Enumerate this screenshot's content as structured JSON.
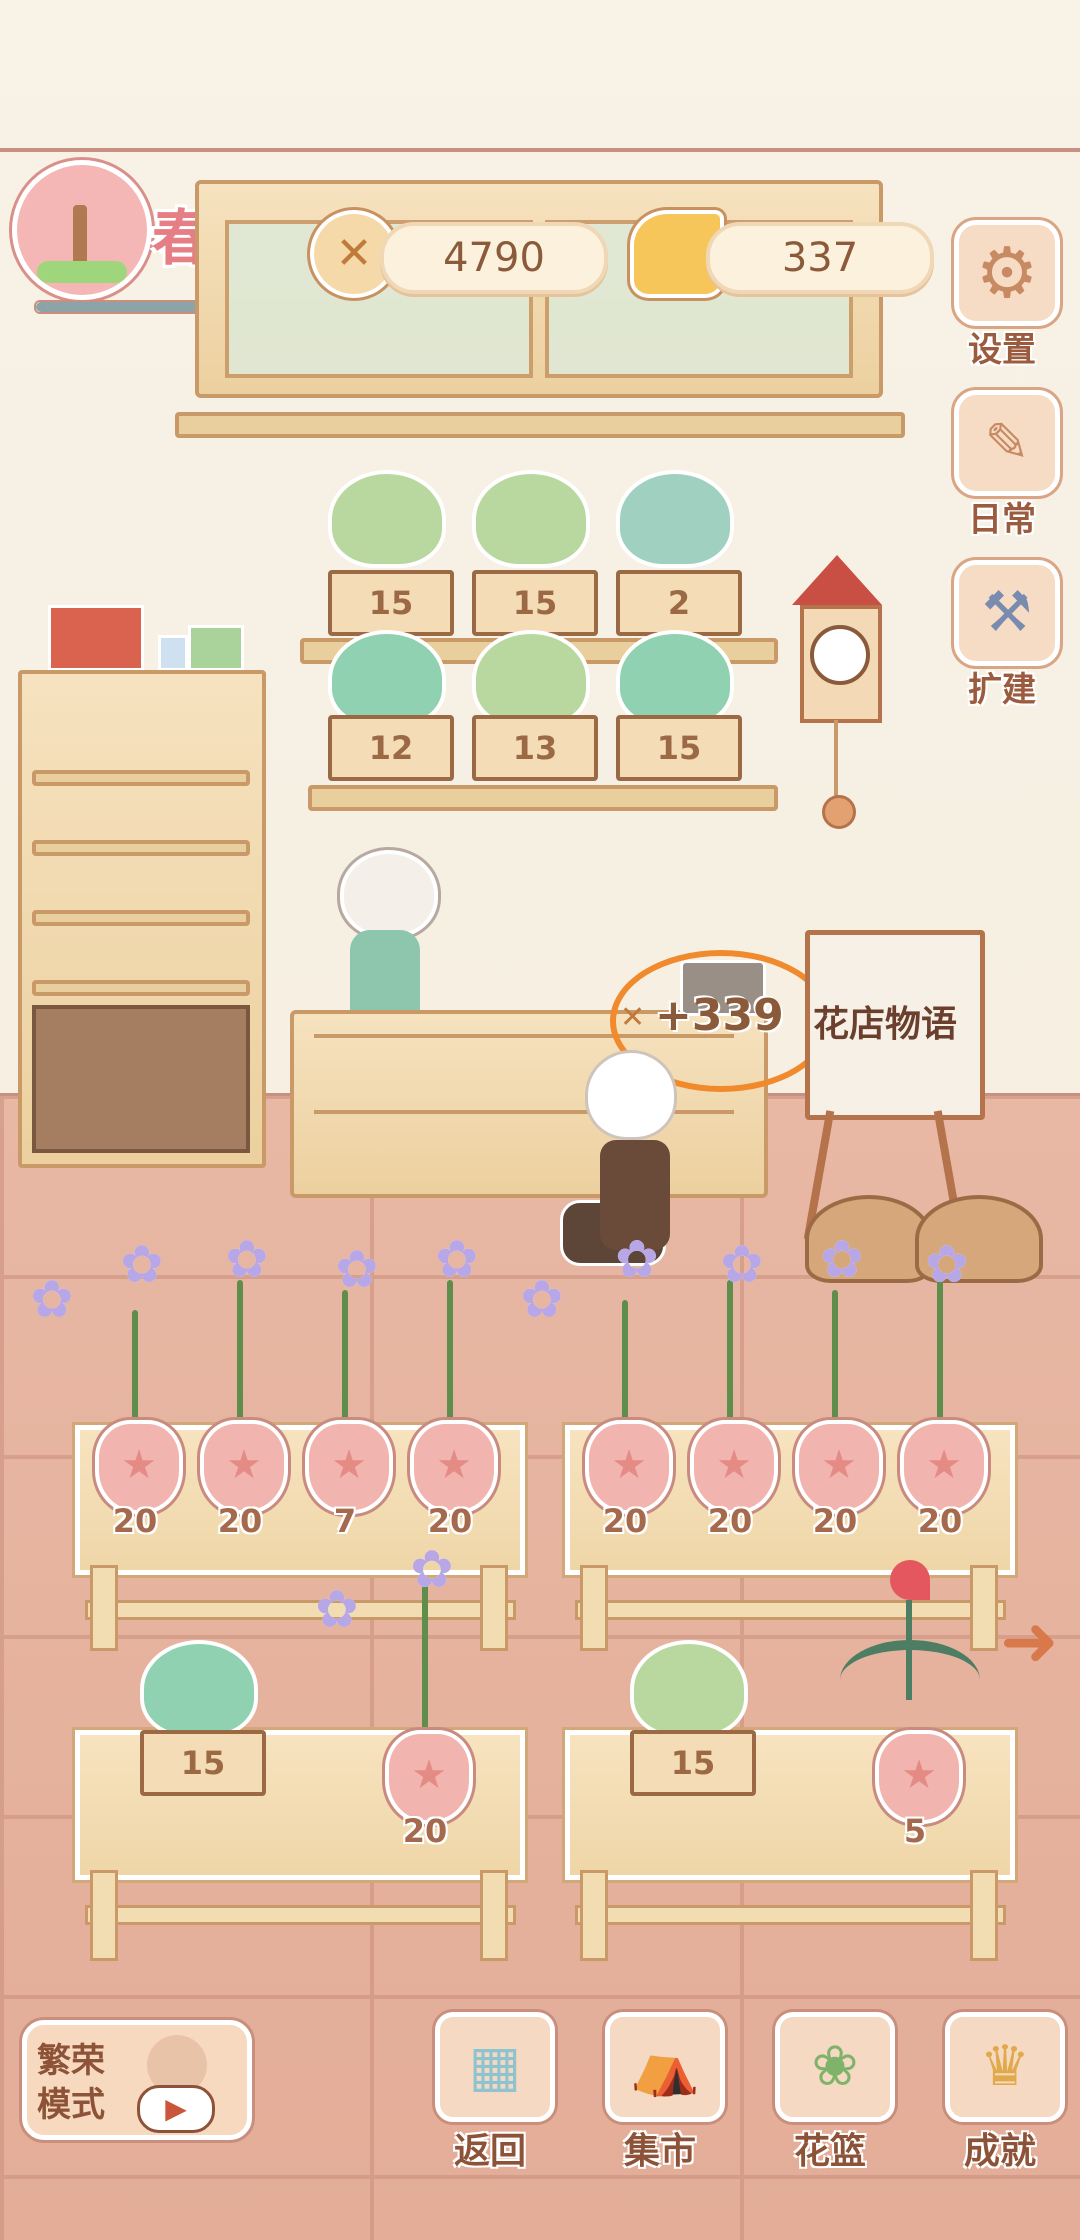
{
  "hud": {
    "season_label": "春",
    "fish_count": "4790",
    "cheese_count": "337"
  },
  "side_menu": [
    {
      "label": "设置",
      "icon": "gear-icon"
    },
    {
      "label": "日常",
      "icon": "tip-note-icon"
    },
    {
      "label": "扩建",
      "icon": "hammer-icon"
    }
  ],
  "display_crates_top": [
    "15",
    "15",
    "2"
  ],
  "display_crates_bottom": [
    "12",
    "13",
    "15"
  ],
  "sign_text": "花店物语",
  "sale_popup": "+339",
  "planter_left_top": [
    "20",
    "20",
    "7",
    "20"
  ],
  "planter_right_top": [
    "20",
    "20",
    "20",
    "20"
  ],
  "planter_left_bottom": {
    "crate": "15",
    "pot": "20"
  },
  "planter_right_bottom": {
    "crate": "15",
    "pot": "5"
  },
  "mode_button": {
    "label_line1": "繁荣",
    "label_line2": "模式"
  },
  "bottom_nav": [
    {
      "label": "返回",
      "icon": "window-icon"
    },
    {
      "label": "集市",
      "icon": "market-stall-icon"
    },
    {
      "label": "花篮",
      "icon": "flower-basket-icon"
    },
    {
      "label": "成就",
      "icon": "trophy-icon"
    }
  ],
  "colors": {
    "accent": "#9b5b3e",
    "wall": "#f6efe2",
    "floor": "#e3ad98",
    "highlight_circle": "#f08a2c"
  }
}
